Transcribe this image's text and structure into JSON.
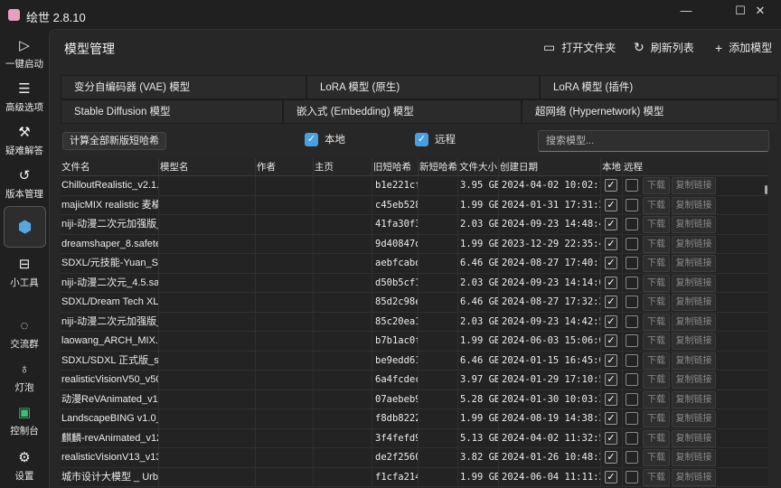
{
  "app": {
    "title": "绘世 2.8.10"
  },
  "window": {
    "minimize": "—",
    "maximize": "☐",
    "close": "✕"
  },
  "sidebar": {
    "items": [
      {
        "label": "一键启动",
        "icon": "▷"
      },
      {
        "label": "高级选项",
        "icon": "☰"
      },
      {
        "label": "疑难解答",
        "icon": "⚒"
      },
      {
        "label": "版本管理",
        "icon": "↺"
      },
      {
        "label": "",
        "icon": "⬢"
      },
      {
        "label": "小工具",
        "icon": "⊟"
      },
      {
        "label": "交流群",
        "icon": "◌"
      },
      {
        "label": "灯泡",
        "icon": "♁"
      },
      {
        "label": "控制台",
        "icon": "▣"
      },
      {
        "label": "设置",
        "icon": "⚙"
      }
    ]
  },
  "header": {
    "title": "模型管理",
    "open_folder": "打开文件夹",
    "refresh": "刷新列表",
    "add_model": "添加模型",
    "open_folder_icon": "▭",
    "refresh_icon": "↻",
    "add_icon": "+"
  },
  "tabs": [
    "变分自编码器 (VAE) 模型",
    "LoRA 模型 (原生)",
    "LoRA 模型 (插件)",
    "Stable Diffusion 模型",
    "嵌入式 (Embedding) 模型",
    "超网络 (Hypernetwork) 模型"
  ],
  "controls": {
    "calc_button": "计算全部新版短哈希",
    "local_label": "本地",
    "remote_label": "远程",
    "search_placeholder": "搜索模型..."
  },
  "table": {
    "columns": [
      "文件名",
      "模型名",
      "作者",
      "主页",
      "旧短哈希",
      "新短哈希",
      "文件大小",
      "创建日期",
      "本地",
      "远程"
    ],
    "download_label": "下载",
    "copy_label": "复制链接",
    "rows": [
      {
        "file": "ChilloutRealistic_v2.1.sa",
        "old": "b1e221cf",
        "size": "3.95 GB",
        "date": "2024-04-02 10:02:13"
      },
      {
        "file": "majicMIX realistic 麦橘写",
        "old": "c45eb528",
        "size": "1.99 GB",
        "date": "2024-01-31 17:31:23"
      },
      {
        "file": "niji-动漫二次元加强版_2.",
        "old": "41fa30f3",
        "size": "2.03 GB",
        "date": "2024-09-23 14:48:41"
      },
      {
        "file": "dreamshaper_8.safeten",
        "old": "9d40847d",
        "size": "1.99 GB",
        "date": "2023-12-29 22:35:48"
      },
      {
        "file": "SDXL/元技能-Yuan_SDX",
        "old": "aebfcabd",
        "size": "6.46 GB",
        "date": "2024-08-27 17:40:19"
      },
      {
        "file": "niji-动漫二次元_4.5.safe",
        "old": "d50b5cf1",
        "size": "2.03 GB",
        "date": "2024-09-23 14:14:04"
      },
      {
        "file": "SDXL/Dream Tech XL _",
        "old": "85d2c98e",
        "size": "6.46 GB",
        "date": "2024-08-27 17:32:25"
      },
      {
        "file": "niji-动漫二次元加强版_偏",
        "old": "85c20ea1",
        "size": "2.03 GB",
        "date": "2024-09-23 14:42:58"
      },
      {
        "file": "laowang_ARCH_MIX.V0",
        "old": "b7b1ac0f",
        "size": "1.99 GB",
        "date": "2024-06-03 15:06:06"
      },
      {
        "file": "SDXL/SDXL 正式版_sdxl",
        "old": "be9edd61",
        "size": "6.46 GB",
        "date": "2024-01-15 16:45:03"
      },
      {
        "file": "realisticVisionV50_v50V",
        "old": "6a4fcdec",
        "size": "3.97 GB",
        "date": "2024-01-29 17:10:51"
      },
      {
        "file": "动漫ReVAnimated_v1.1",
        "old": "07aebeb9",
        "size": "5.28 GB",
        "date": "2024-01-30 10:03:38"
      },
      {
        "file": "LandscapeBING  v1.0_l",
        "old": "f8db8222",
        "size": "1.99 GB",
        "date": "2024-08-19 14:38:21"
      },
      {
        "file": "麒麟-revAnimated_v122",
        "old": "3f4fefd9",
        "size": "5.13 GB",
        "date": "2024-04-02 11:32:58"
      },
      {
        "file": "realisticVisionV13_v13.s",
        "old": "de2f2560",
        "size": "3.82 GB",
        "date": "2024-01-26 10:48:22"
      },
      {
        "file": "城市设计大模型 _ Urban",
        "old": "f1cfa214",
        "size": "1.99 GB",
        "date": "2024-06-04 11:11:23"
      }
    ]
  }
}
